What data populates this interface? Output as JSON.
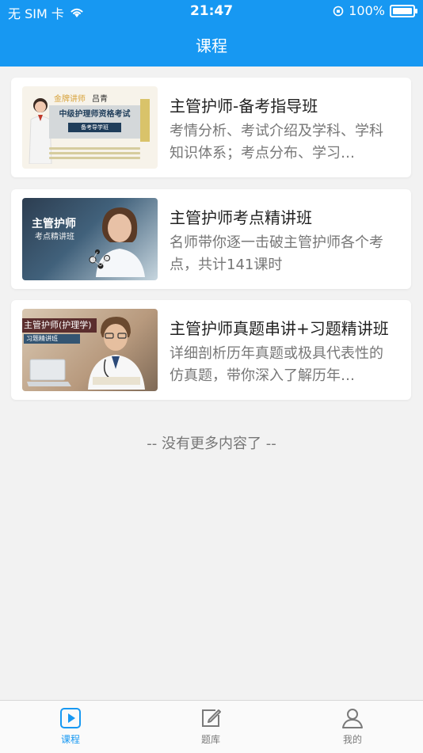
{
  "status_bar": {
    "carrier": "无 SIM 卡",
    "time": "21:47",
    "battery": "100%",
    "battery_level": 1.0
  },
  "header": {
    "title": "课程"
  },
  "courses": [
    {
      "title": "主管护师-备考指导班",
      "desc": "考情分析、考试介绍及学科、学科知识体系；考点分布、学习…",
      "thumb": {
        "tag": "金牌讲师",
        "name": "吕青",
        "exam": "中级护理师资格考试",
        "sub": "备考导学班"
      }
    },
    {
      "title": "主管护师考点精讲班",
      "desc": "名师带你逐一击破主管护师各个考点，共计141课时",
      "thumb": {
        "title": "主管护师",
        "sub": "考点精讲班"
      }
    },
    {
      "title": "主管护师真题串讲+习题精讲班",
      "desc": "详细剖析历年真题或极具代表性的仿真题，带你深入了解历年…",
      "thumb": {
        "title": "主管护师(护理学)",
        "sub": "习题精讲班"
      }
    }
  ],
  "list_end": "-- 没有更多内容了 --",
  "tabs": [
    {
      "label": "课程",
      "icon": "play-icon",
      "active": true
    },
    {
      "label": "题库",
      "icon": "edit-icon",
      "active": false
    },
    {
      "label": "我的",
      "icon": "user-icon",
      "active": false
    }
  ],
  "colors": {
    "primary": "#1798f2",
    "inactive": "#7a7a7a"
  }
}
